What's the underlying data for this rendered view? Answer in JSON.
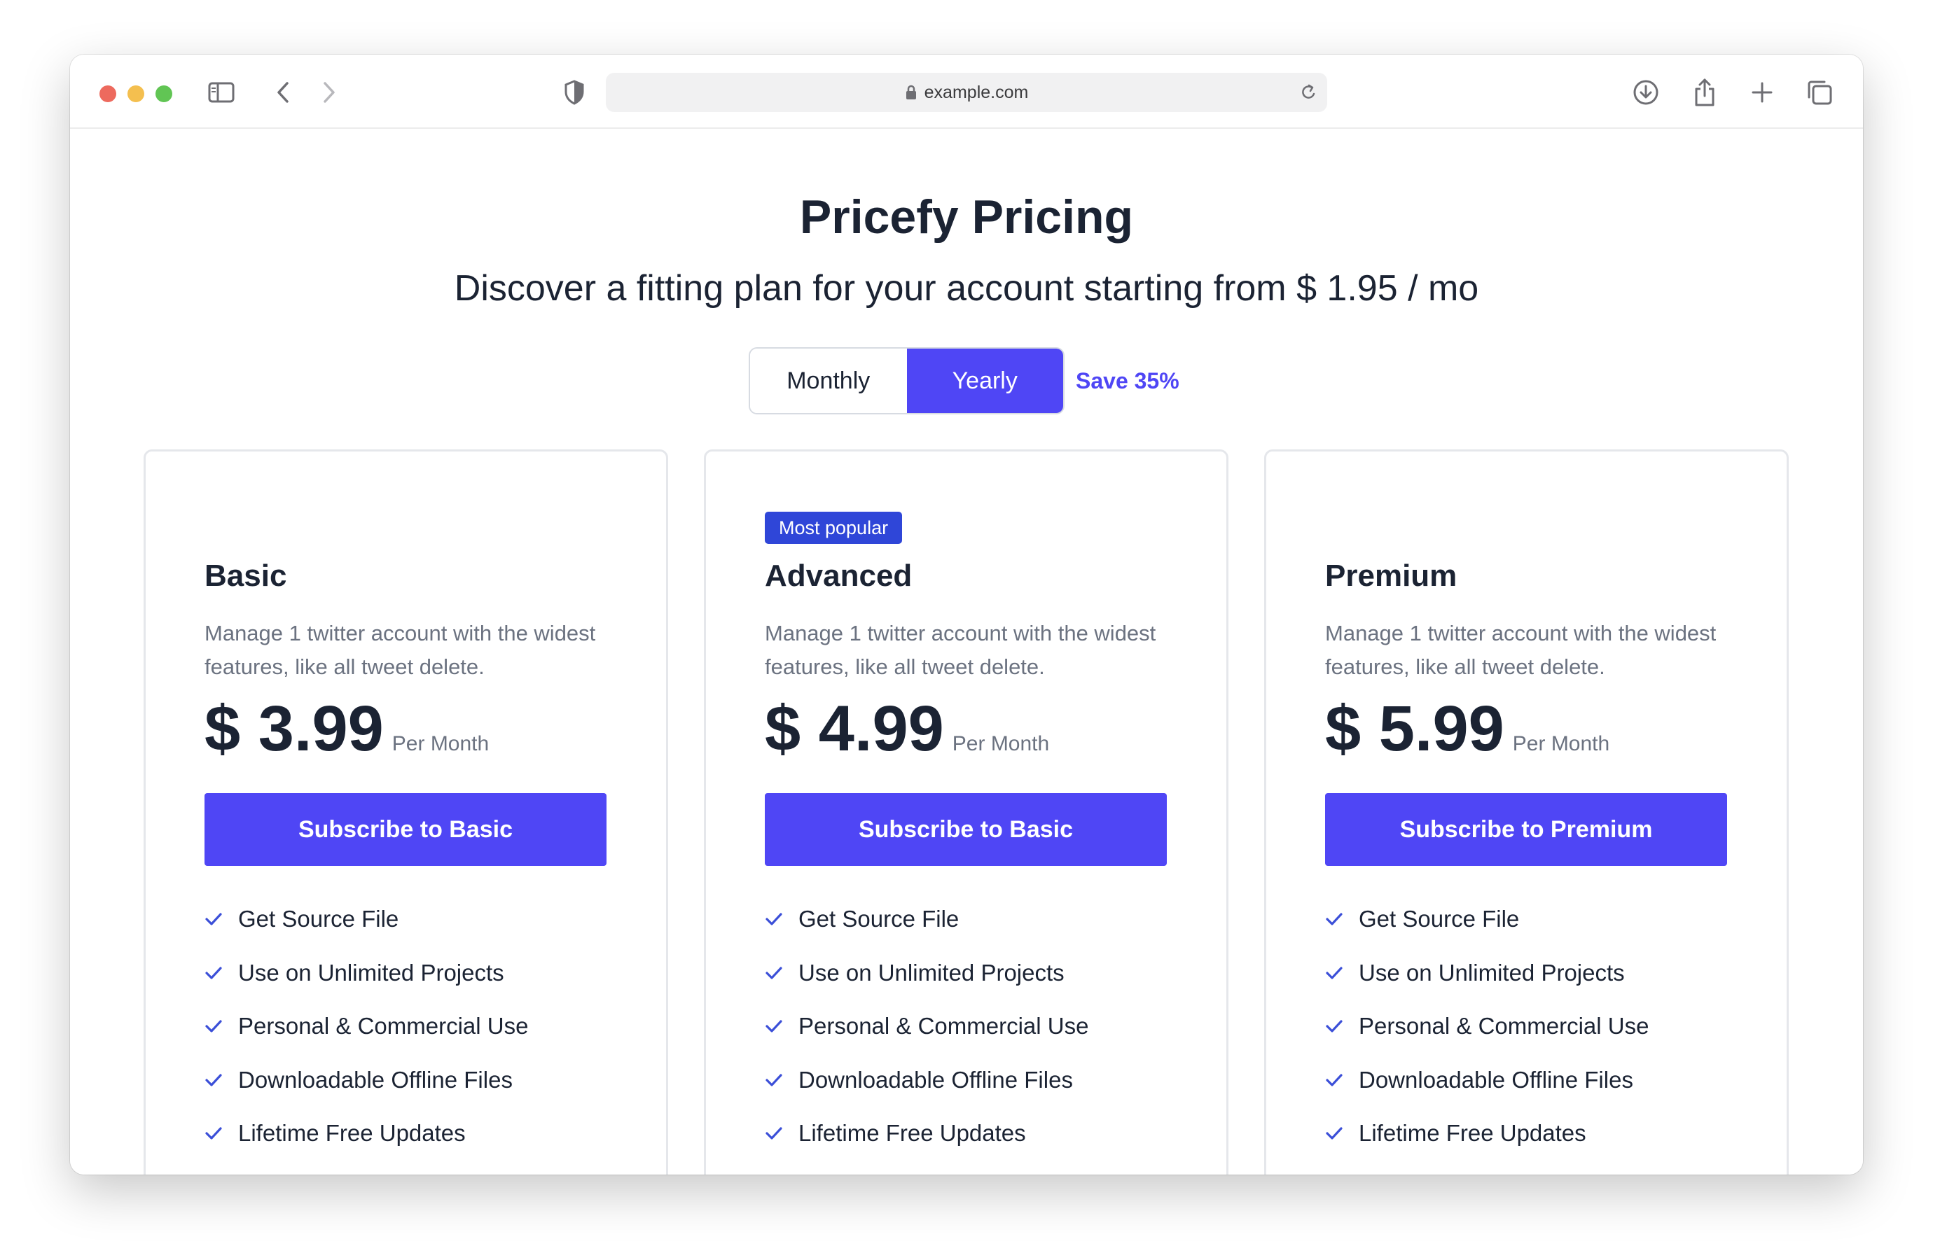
{
  "browser": {
    "url": "example.com",
    "icons": {
      "sidebar": "sidebar-icon",
      "back": "chevron-left-icon",
      "forward": "chevron-right-icon",
      "privacy": "shield-icon",
      "lock": "lock-icon",
      "reload": "reload-icon",
      "download": "download-icon",
      "share": "share-icon",
      "new_tab": "plus-icon",
      "tabs": "tabs-overview-icon"
    }
  },
  "header": {
    "title": "Pricefy Pricing",
    "subtitle": "Discover a fitting plan for your account starting from $ 1.95 / mo"
  },
  "billing_toggle": {
    "monthly": "Monthly",
    "yearly": "Yearly",
    "selected": "Yearly",
    "save_note": "Save 35%"
  },
  "colors": {
    "accent": "#4f46f5",
    "badge": "#2f46d8",
    "text": "#1b2333",
    "muted": "#6b7280"
  },
  "plans": [
    {
      "name": "Basic",
      "badge": "",
      "description": "Manage 1 twitter account with the widest features, like all tweet delete.",
      "price": "$ 3.99",
      "period": "Per Month",
      "cta": "Subscribe to Basic",
      "features": [
        "Get Source File",
        "Use on Unlimited Projects",
        "Personal & Commercial Use",
        "Downloadable Offline Files",
        "Lifetime Free Updates"
      ]
    },
    {
      "name": "Advanced",
      "badge": "Most popular",
      "description": "Manage 1 twitter account with the widest features, like all tweet delete.",
      "price": "$ 4.99",
      "period": "Per Month",
      "cta": "Subscribe to Basic",
      "features": [
        "Get Source File",
        "Use on Unlimited Projects",
        "Personal & Commercial Use",
        "Downloadable Offline Files",
        "Lifetime Free Updates"
      ]
    },
    {
      "name": "Premium",
      "badge": "",
      "description": "Manage 1 twitter account with the widest features, like all tweet delete.",
      "price": "$ 5.99",
      "period": "Per Month",
      "cta": "Subscribe to Premium",
      "features": [
        "Get Source File",
        "Use on Unlimited Projects",
        "Personal & Commercial Use",
        "Downloadable Offline Files",
        "Lifetime Free Updates"
      ]
    }
  ]
}
